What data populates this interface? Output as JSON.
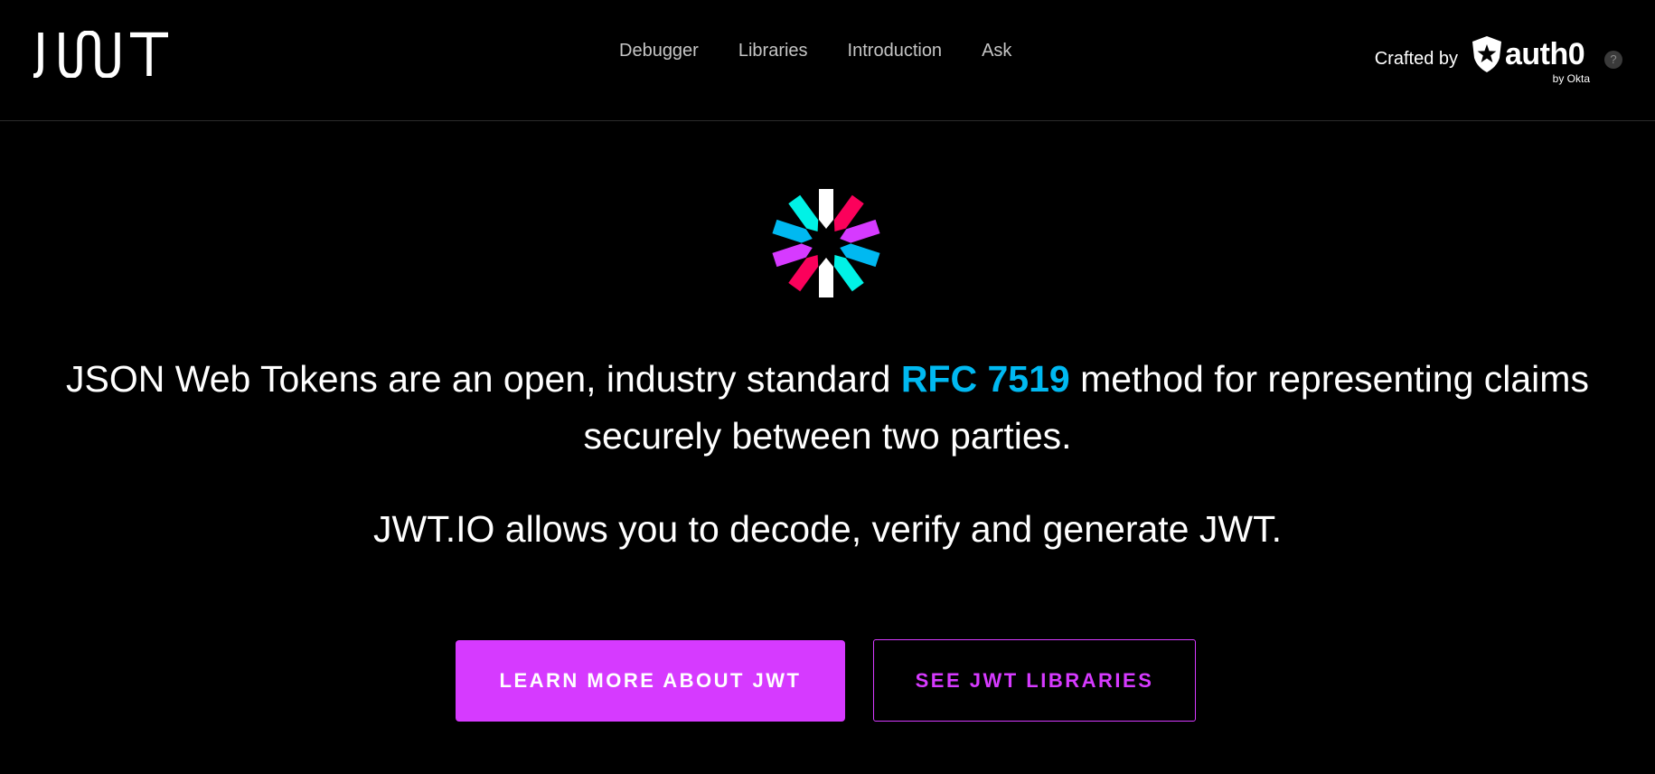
{
  "header": {
    "logo_text": "JWT",
    "nav": [
      {
        "label": "Debugger"
      },
      {
        "label": "Libraries"
      },
      {
        "label": "Introduction"
      },
      {
        "label": "Ask"
      }
    ],
    "crafted_label": "Crafted by",
    "auth0_wordmark": "auth0",
    "auth0_sub": "by Okta",
    "help_symbol": "?"
  },
  "hero": {
    "headline_before": "JSON Web Tokens are an open, industry standard ",
    "headline_link": "RFC 7519",
    "headline_after": " method for representing claims securely between two parties.",
    "subline": "JWT.IO allows you to decode, verify and generate JWT.",
    "primary_button": "LEARN MORE ABOUT JWT",
    "secondary_button": "SEE JWT LIBRARIES"
  },
  "colors": {
    "background": "#000000",
    "accent_purple": "#d63aff",
    "link_blue": "#00b9f1",
    "emblem_white": "#ffffff",
    "emblem_pink": "#fb015b",
    "emblem_purple": "#d63aff",
    "emblem_cyan": "#00f2e6",
    "emblem_blue": "#00b9f1"
  },
  "icons": {
    "logo": "jwt-logo-icon",
    "emblem": "jwt-emblem-icon",
    "auth0_shield": "auth0-shield-icon",
    "help": "help-icon"
  }
}
